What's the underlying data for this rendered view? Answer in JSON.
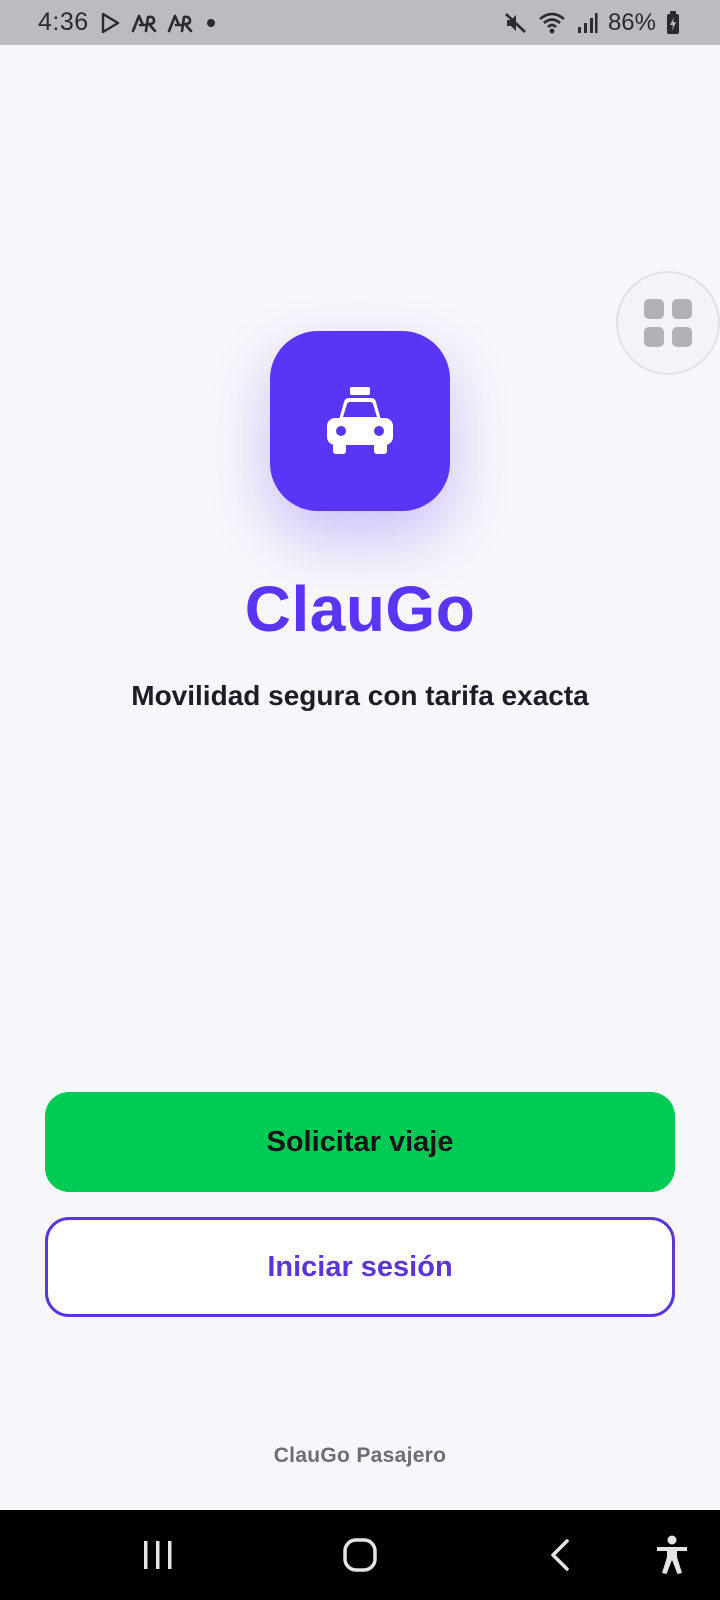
{
  "status_bar": {
    "time": "4:36",
    "battery": "86%",
    "notification_icons": [
      "play-store-icon",
      "ar-icon",
      "ar-icon",
      "dot-icon"
    ],
    "system_icons": [
      "mute-icon",
      "wifi-icon",
      "signal-icon",
      "battery-charging-icon"
    ]
  },
  "floating_button": {
    "icon": "grid-icon"
  },
  "logo": {
    "icon": "taxi-icon",
    "color": "#5b35f5"
  },
  "app": {
    "title": "ClauGo",
    "subtitle": "Movilidad segura con tarifa exacta"
  },
  "actions": {
    "primary_label": "Solicitar viaje",
    "secondary_label": "Iniciar sesión"
  },
  "footer": {
    "label": "ClauGo Pasajero"
  },
  "colors": {
    "brand": "#5b35f5",
    "primary_button": "#00cc55",
    "outline": "#5b35d5",
    "background": "#f7f6fb"
  },
  "nav_bar": {
    "buttons": [
      "recents-icon",
      "home-icon",
      "back-icon",
      "accessibility-icon"
    ]
  }
}
